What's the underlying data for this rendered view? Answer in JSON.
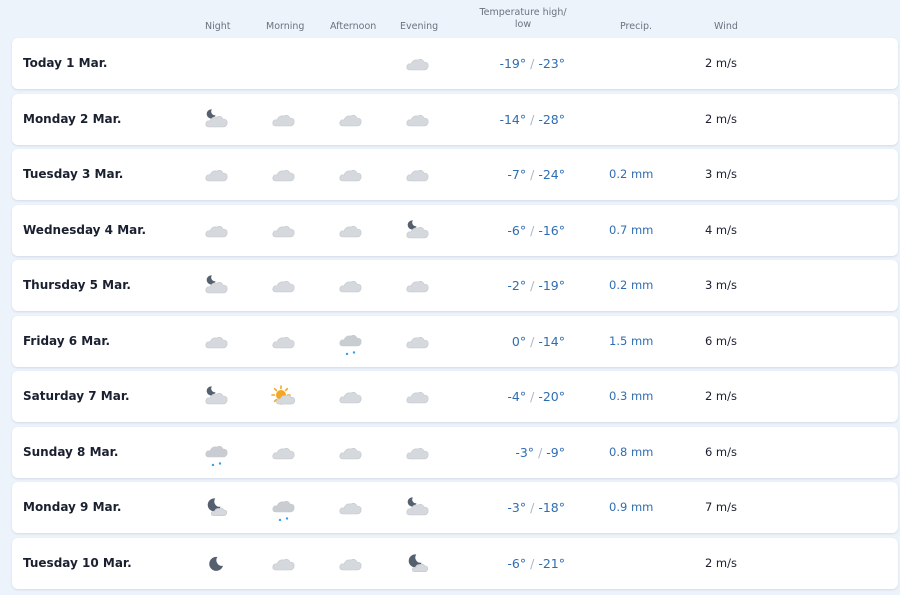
{
  "header": {
    "night": "Night",
    "morning": "Morning",
    "afternoon": "Afternoon",
    "evening": "Evening",
    "temp": "Temperature high/ low",
    "precip": "Precip.",
    "wind": "Wind"
  },
  "colors": {
    "page_bg": "#ecf3fb",
    "row_bg": "#ffffff",
    "temp_text": "#2f6db3",
    "cloud": "#d5d8dc",
    "moon": "#55606e",
    "sun": "#f5a623",
    "snow": "#38a1e8"
  },
  "days": [
    {
      "day": "Today 1 Mar.",
      "icons": [
        null,
        null,
        null,
        "cloud-icon"
      ],
      "high": "-19°",
      "low": "-23°",
      "precip": "",
      "wind": "2 m/s"
    },
    {
      "day": "Monday 2 Mar.",
      "icons": [
        "moon-cloud-icon",
        "cloud-icon",
        "cloud-icon",
        "cloud-icon"
      ],
      "high": "-14°",
      "low": "-28°",
      "precip": "",
      "wind": "2 m/s"
    },
    {
      "day": "Tuesday 3 Mar.",
      "icons": [
        "cloud-icon",
        "cloud-icon",
        "cloud-icon",
        "cloud-icon"
      ],
      "high": "-7°",
      "low": "-24°",
      "precip": "0.2 mm",
      "wind": "3 m/s"
    },
    {
      "day": "Wednesday 4 Mar.",
      "icons": [
        "cloud-icon",
        "cloud-icon",
        "cloud-icon",
        "moon-cloud-icon"
      ],
      "high": "-6°",
      "low": "-16°",
      "precip": "0.7 mm",
      "wind": "4 m/s"
    },
    {
      "day": "Thursday 5 Mar.",
      "icons": [
        "moon-cloud-icon",
        "cloud-icon",
        "cloud-icon",
        "cloud-icon"
      ],
      "high": "-2°",
      "low": "-19°",
      "precip": "0.2 mm",
      "wind": "3 m/s"
    },
    {
      "day": "Friday 6 Mar.",
      "icons": [
        "cloud-icon",
        "cloud-icon",
        "snow-cloud-icon",
        "cloud-icon"
      ],
      "high": "0°",
      "low": "-14°",
      "precip": "1.5 mm",
      "wind": "6 m/s"
    },
    {
      "day": "Saturday 7 Mar.",
      "icons": [
        "moon-cloud-icon",
        "sun-cloud-icon",
        "cloud-icon",
        "cloud-icon"
      ],
      "high": "-4°",
      "low": "-20°",
      "precip": "0.3 mm",
      "wind": "2 m/s"
    },
    {
      "day": "Sunday 8 Mar.",
      "icons": [
        "snow-cloud-icon",
        "cloud-icon",
        "cloud-icon",
        "cloud-icon"
      ],
      "high": "-3°",
      "low": "-9°",
      "precip": "0.8 mm",
      "wind": "6 m/s"
    },
    {
      "day": "Monday 9 Mar.",
      "icons": [
        "moon-small-cloud-icon",
        "snow-cloud-icon",
        "cloud-icon",
        "moon-cloud-icon"
      ],
      "high": "-3°",
      "low": "-18°",
      "precip": "0.9 mm",
      "wind": "7 m/s"
    },
    {
      "day": "Tuesday 10 Mar.",
      "icons": [
        "moon-icon",
        "cloud-icon",
        "cloud-icon",
        "moon-small-cloud-icon"
      ],
      "high": "-6°",
      "low": "-21°",
      "precip": "",
      "wind": "2 m/s"
    }
  ]
}
